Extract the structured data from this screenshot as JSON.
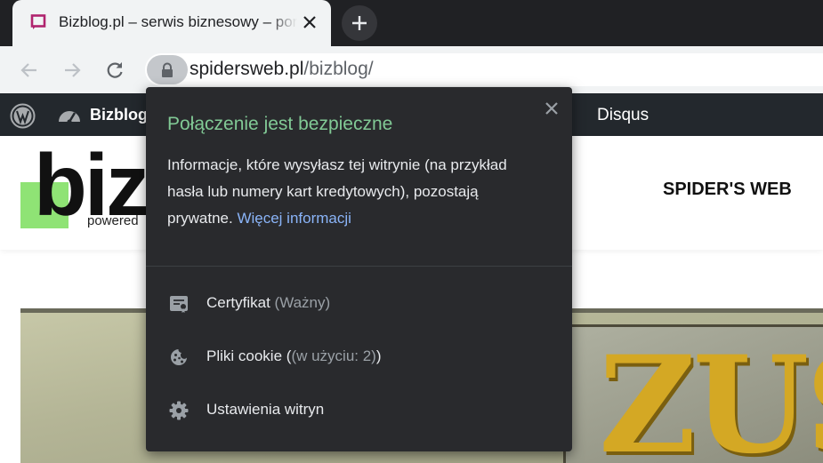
{
  "browser": {
    "tab": {
      "title": "Bizblog.pl – serwis biznesowy – portal"
    },
    "address": {
      "host": "spidersweb.pl",
      "path": "/bizblog/"
    }
  },
  "adminbar": {
    "site_name": "Bizblog",
    "disqus": "Disqus"
  },
  "page": {
    "logo_text": "biz",
    "powered": "powered",
    "network": "SPIDER'S WEB"
  },
  "popup": {
    "title": "Połączenie jest bezpieczne",
    "description": "Informacje, które wysyłasz tej witrynie (na przykład hasła lub numery kart kredytowych), pozostają prywatne.",
    "more_link": "Więcej informacji",
    "items": [
      {
        "label": "Certyfikat",
        "sub": "(Ważny)",
        "icon": "certificate-icon"
      },
      {
        "label": "Pliki cookie",
        "sub": "(w użyciu: 2)",
        "icon": "cookie-icon"
      },
      {
        "label": "Ustawienia witryn",
        "icon": "gear-icon"
      }
    ]
  },
  "colors": {
    "popup_title": "#81c995",
    "link": "#8ab4f8",
    "logo_green": "#8fe375",
    "admin_bar": "#23282d"
  }
}
